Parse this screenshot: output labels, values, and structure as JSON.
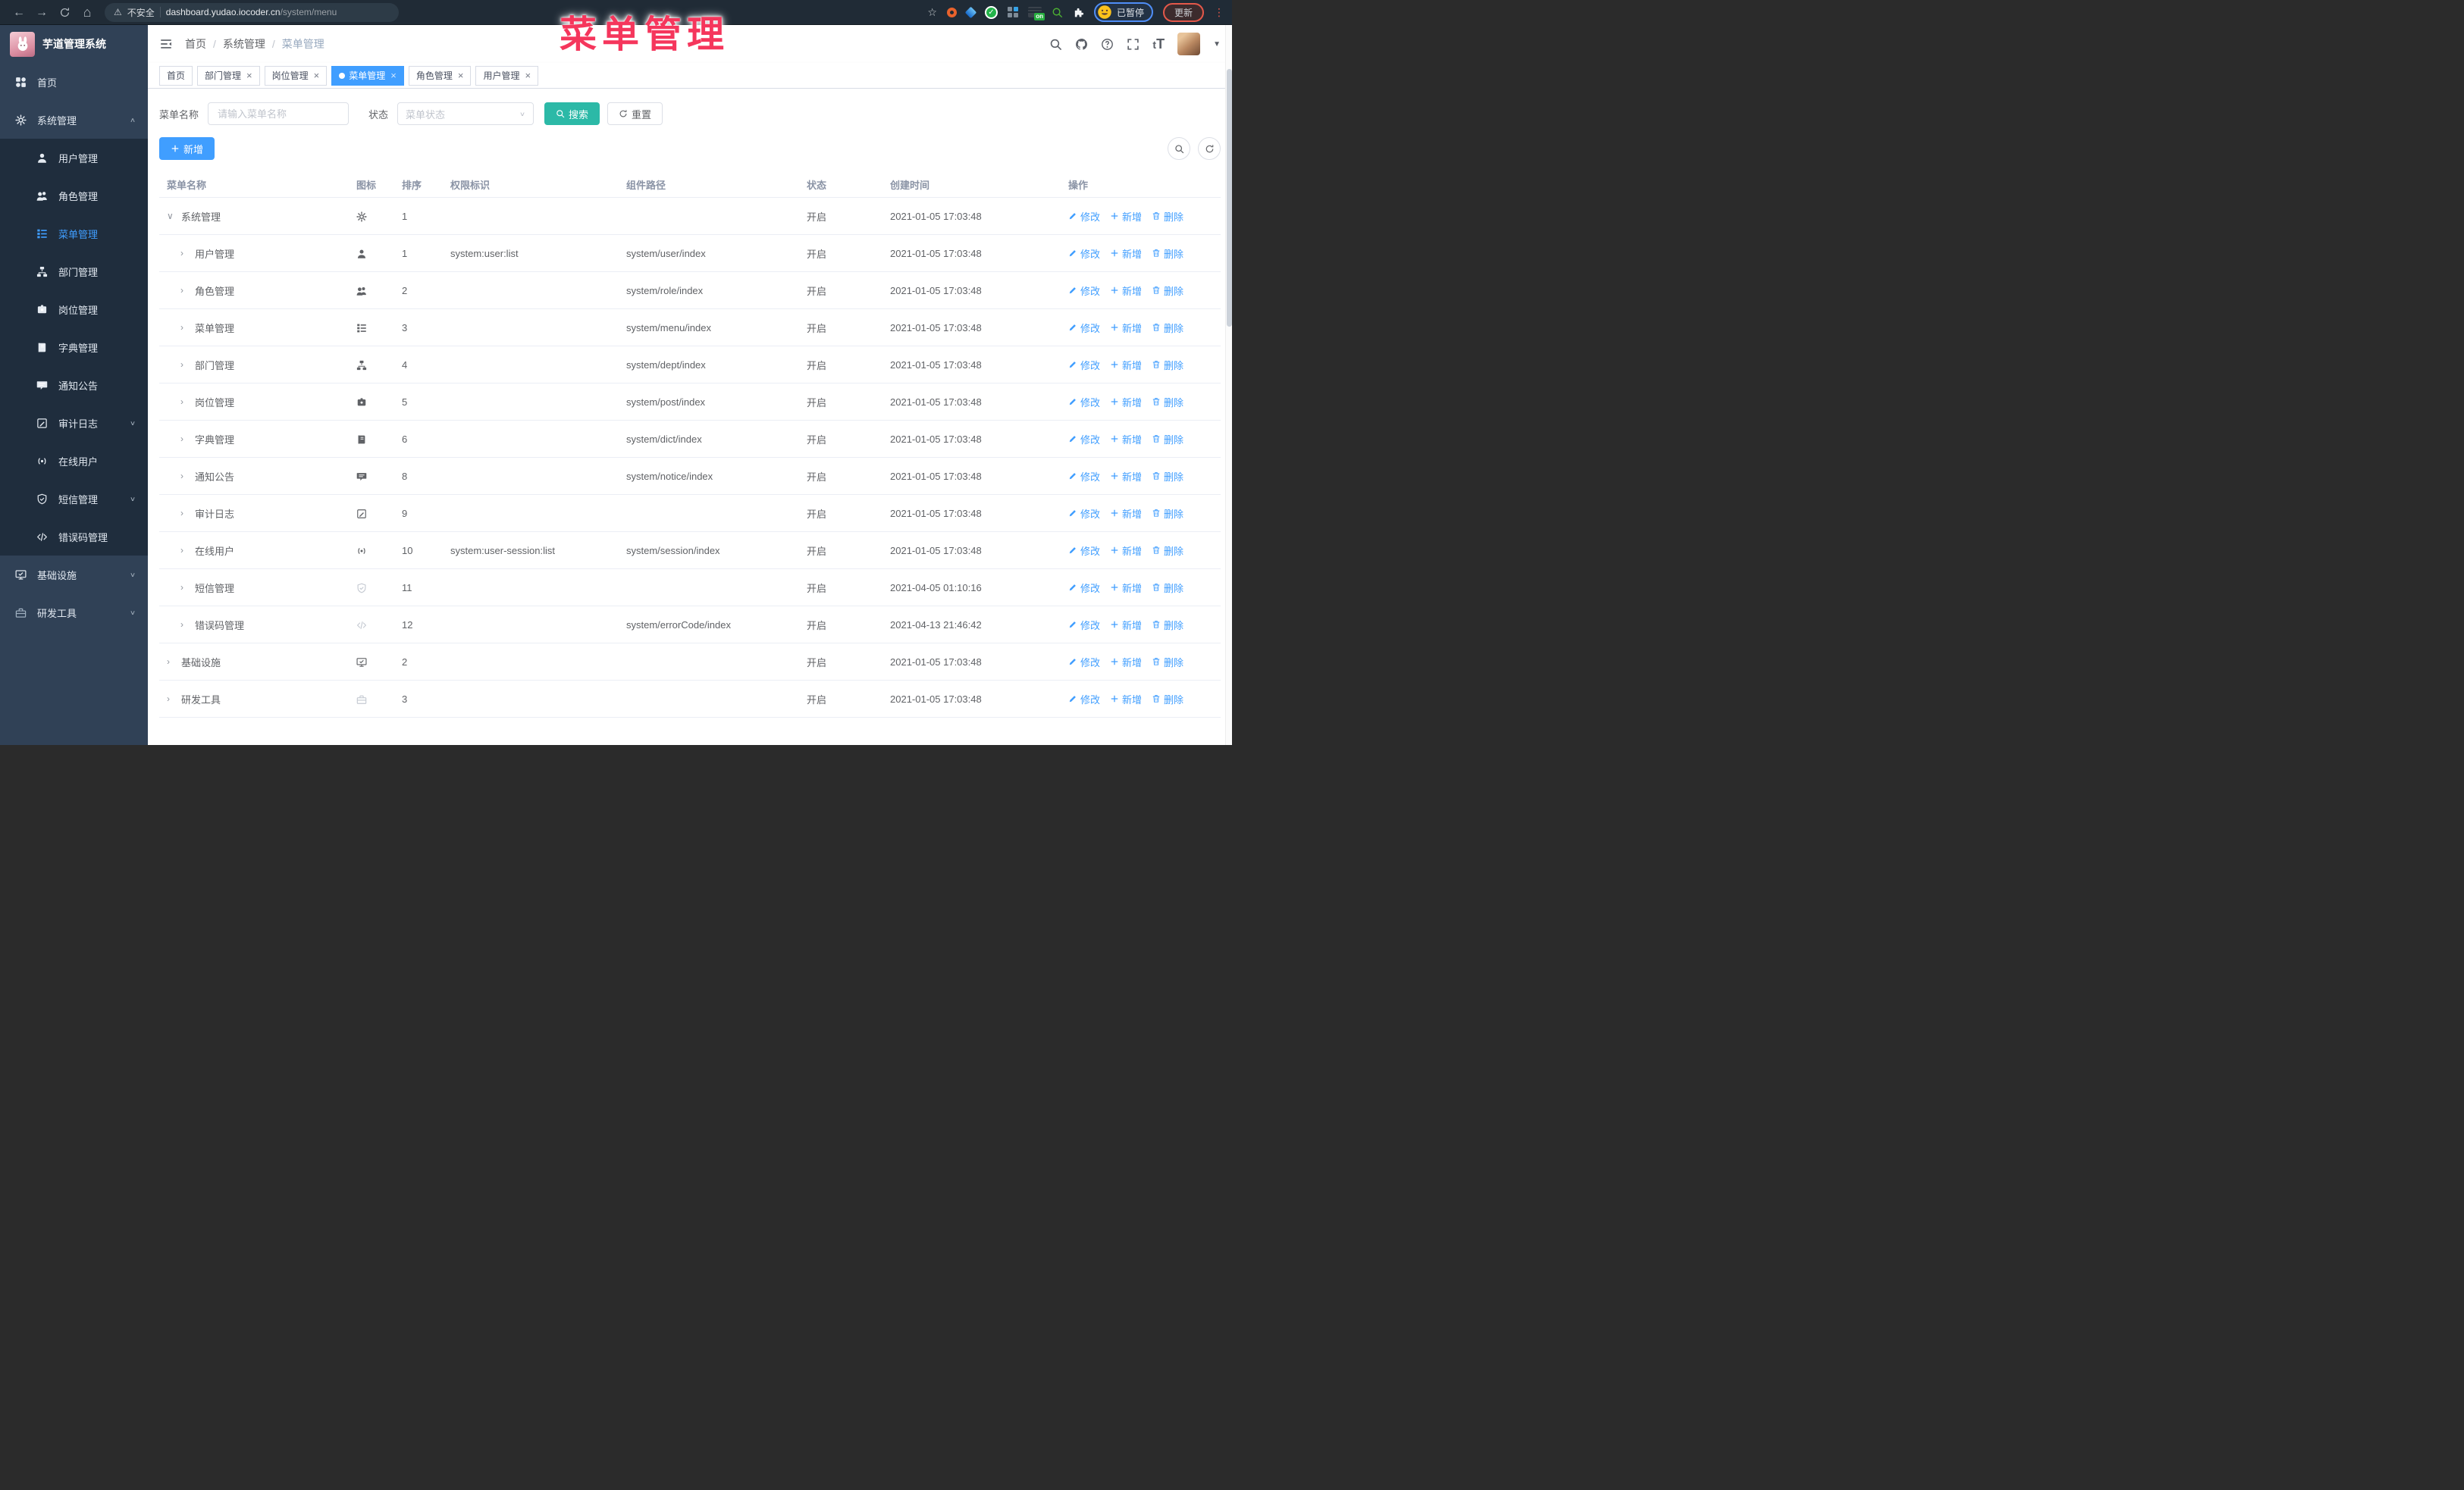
{
  "browser": {
    "security_label": "不安全",
    "url_domain": "dashboard.yudao.iocoder.cn",
    "url_path": "/system/menu",
    "on_badge": "on",
    "paused_badge": "已暂停",
    "update_button": "更新"
  },
  "annotation": {
    "text": "菜单管理",
    "color": "#f5365c"
  },
  "sidebar": {
    "logo_title": "芋道管理系统",
    "items": [
      {
        "label": "首页",
        "icon": "dashboard"
      },
      {
        "label": "系统管理",
        "icon": "gear",
        "expanded": true,
        "children": [
          {
            "label": "用户管理",
            "icon": "user"
          },
          {
            "label": "角色管理",
            "icon": "users"
          },
          {
            "label": "菜单管理",
            "icon": "menu",
            "active": true
          },
          {
            "label": "部门管理",
            "icon": "tree"
          },
          {
            "label": "岗位管理",
            "icon": "badge"
          },
          {
            "label": "字典管理",
            "icon": "book"
          },
          {
            "label": "通知公告",
            "icon": "message"
          },
          {
            "label": "审计日志",
            "icon": "log",
            "collapsible": true
          },
          {
            "label": "在线用户",
            "icon": "online"
          },
          {
            "label": "短信管理",
            "icon": "shield",
            "collapsible": true
          },
          {
            "label": "错误码管理",
            "icon": "code"
          }
        ]
      },
      {
        "label": "基础设施",
        "icon": "monitor",
        "collapsible": true
      },
      {
        "label": "研发工具",
        "icon": "toolbox",
        "collapsible": true,
        "faded": true
      }
    ]
  },
  "header": {
    "breadcrumb": [
      "首页",
      "系统管理",
      "菜单管理"
    ]
  },
  "tabs": [
    {
      "label": "首页",
      "closable": false,
      "active": false
    },
    {
      "label": "部门管理",
      "closable": true,
      "active": false
    },
    {
      "label": "岗位管理",
      "closable": true,
      "active": false
    },
    {
      "label": "菜单管理",
      "closable": true,
      "active": true
    },
    {
      "label": "角色管理",
      "closable": true,
      "active": false
    },
    {
      "label": "用户管理",
      "closable": true,
      "active": false
    }
  ],
  "filters": {
    "name_label": "菜单名称",
    "name_placeholder": "请输入菜单名称",
    "status_label": "状态",
    "status_placeholder": "菜单状态",
    "search_button": "搜索",
    "reset_button": "重置"
  },
  "toolbar": {
    "add_button": "新增"
  },
  "colors": {
    "accent": "#409eff",
    "search_button": "#2cb9a7",
    "annotation": "#f5365c",
    "sidebar_bg": "#304156",
    "submenu_bg": "#1f2d3d"
  },
  "table": {
    "columns": [
      "菜单名称",
      "图标",
      "排序",
      "权限标识",
      "组件路径",
      "状态",
      "创建时间",
      "操作"
    ],
    "actions": [
      "修改",
      "新增",
      "删除"
    ],
    "rows": [
      {
        "name": "系统管理",
        "icon": "gear",
        "level": 0,
        "expanded": true,
        "sort": "1",
        "perm": "",
        "path": "",
        "status": "开启",
        "time": "2021-01-05 17:03:48"
      },
      {
        "name": "用户管理",
        "icon": "user",
        "level": 1,
        "sort": "1",
        "perm": "system:user:list",
        "path": "system/user/index",
        "status": "开启",
        "time": "2021-01-05 17:03:48"
      },
      {
        "name": "角色管理",
        "icon": "users",
        "level": 1,
        "sort": "2",
        "perm": "",
        "path": "system/role/index",
        "status": "开启",
        "time": "2021-01-05 17:03:48"
      },
      {
        "name": "菜单管理",
        "icon": "menu",
        "level": 1,
        "sort": "3",
        "perm": "",
        "path": "system/menu/index",
        "status": "开启",
        "time": "2021-01-05 17:03:48"
      },
      {
        "name": "部门管理",
        "icon": "tree",
        "level": 1,
        "sort": "4",
        "perm": "",
        "path": "system/dept/index",
        "status": "开启",
        "time": "2021-01-05 17:03:48"
      },
      {
        "name": "岗位管理",
        "icon": "badge",
        "level": 1,
        "sort": "5",
        "perm": "",
        "path": "system/post/index",
        "status": "开启",
        "time": "2021-01-05 17:03:48"
      },
      {
        "name": "字典管理",
        "icon": "book",
        "level": 1,
        "sort": "6",
        "perm": "",
        "path": "system/dict/index",
        "status": "开启",
        "time": "2021-01-05 17:03:48"
      },
      {
        "name": "通知公告",
        "icon": "message",
        "level": 1,
        "sort": "8",
        "perm": "",
        "path": "system/notice/index",
        "status": "开启",
        "time": "2021-01-05 17:03:48"
      },
      {
        "name": "审计日志",
        "icon": "log",
        "level": 1,
        "sort": "9",
        "perm": "",
        "path": "",
        "status": "开启",
        "time": "2021-01-05 17:03:48"
      },
      {
        "name": "在线用户",
        "icon": "online",
        "level": 1,
        "sort": "10",
        "perm": "system:user-session:list",
        "path": "system/session/index",
        "status": "开启",
        "time": "2021-01-05 17:03:48"
      },
      {
        "name": "短信管理",
        "icon": "shield",
        "muted": true,
        "level": 1,
        "sort": "11",
        "perm": "",
        "path": "",
        "status": "开启",
        "time": "2021-04-05 01:10:16"
      },
      {
        "name": "错误码管理",
        "icon": "code",
        "muted": true,
        "level": 1,
        "sort": "12",
        "perm": "",
        "path": "system/errorCode/index",
        "status": "开启",
        "time": "2021-04-13 21:46:42"
      },
      {
        "name": "基础设施",
        "icon": "monitor",
        "level": 0,
        "sort": "2",
        "perm": "",
        "path": "",
        "status": "开启",
        "time": "2021-01-05 17:03:48"
      },
      {
        "name": "研发工具",
        "icon": "toolbox",
        "muted": true,
        "level": 0,
        "sort": "3",
        "perm": "",
        "path": "",
        "status": "开启",
        "time": "2021-01-05 17:03:48"
      }
    ]
  }
}
